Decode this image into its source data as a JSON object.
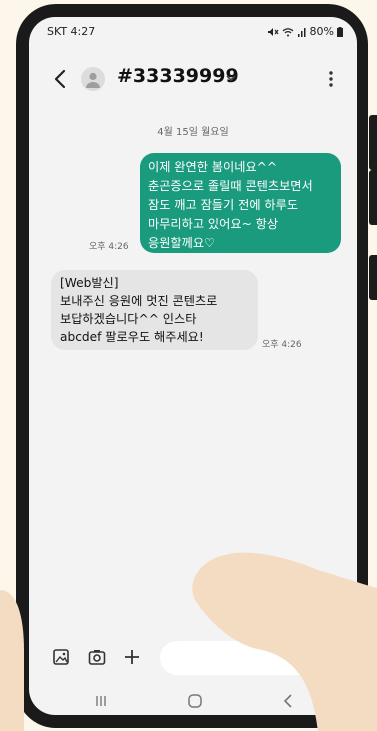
{
  "status_bar": {
    "carrier_time": "SKT 4:27",
    "battery": "80%"
  },
  "conversation": {
    "title": "#33339999"
  },
  "date_divider": "4월 15일 월요일",
  "messages": {
    "outgoing": {
      "text": "이제 완연한 봄이네요^^\n춘곤증으로 졸릴때 콘텐츠보면서\n잠도 깨고 잠들기 전에 하루도\n마무리하고 있어요~ 항상\n응원할께요♡",
      "time": "오후 4:26"
    },
    "incoming": {
      "text": "[Web발신]\n보내주신 응원에 멋진 콘텐츠로\n보답하겠습니다^^ 인스타\nabcdef 팔로우도 해주세요!",
      "time": "오후 4:26"
    }
  },
  "composer": {
    "placeholder": ""
  },
  "colors": {
    "outgoing_bubble": "#1a9b7e",
    "incoming_bubble": "#e5e5e5",
    "skin": "#f3dcc2"
  },
  "icons": [
    "back-arrow-icon",
    "contact-avatar-icon",
    "chevron-down-icon",
    "more-vert-icon",
    "gallery-icon",
    "camera-icon",
    "plus-icon",
    "emoji-icon",
    "recent-apps-icon",
    "home-icon",
    "back-nav-icon"
  ]
}
